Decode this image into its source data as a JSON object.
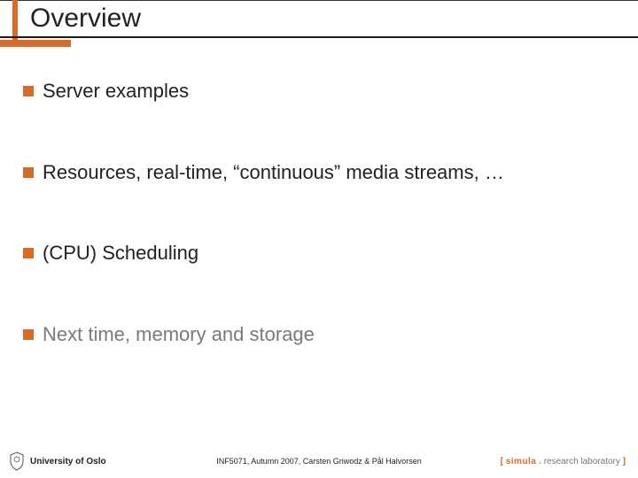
{
  "title": "Overview",
  "bullets": {
    "b1": "Server examples",
    "b2": "Resources, real-time, “continuous” media streams, …",
    "b3": "(CPU) Scheduling",
    "b4": "Next time, memory and storage"
  },
  "footer": {
    "university": "University of Oslo",
    "course": "INF5071, Autumn 2007,  Carsten Griwodz & Pål Halvorsen",
    "lab_bracket_l": "[",
    "lab_name": "simula",
    "lab_dot": ".",
    "lab_rest": "research laboratory",
    "lab_bracket_r": "]"
  }
}
